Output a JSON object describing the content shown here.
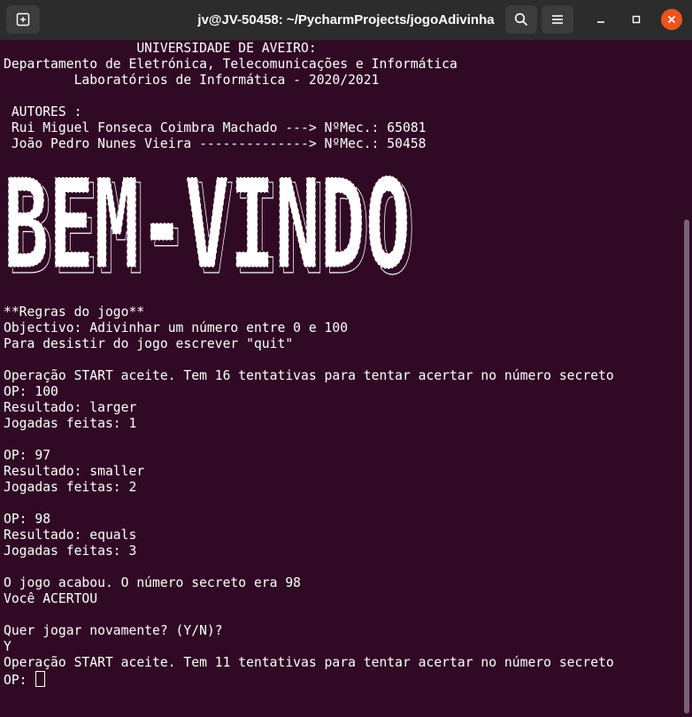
{
  "window": {
    "title": "jv@JV-50458: ~/PycharmProjects/jogoAdivinha",
    "icons": [
      "new-tab-icon",
      "search-icon",
      "hamburger-menu-icon",
      "minimize-icon",
      "maximize-icon",
      "close-icon"
    ],
    "close_color": "#e95420"
  },
  "colors": {
    "terminal_bg": "#300a24",
    "text": "#ffffff",
    "titlebar_bg": "#2c2c2c"
  },
  "header": {
    "university": "                 UNIVERSIDADE DE AVEIRO:",
    "department": "Departamento de Eletrónica, Telecomunicações e Informática",
    "lab": "         Laboratórios de Informática - 2020/2021"
  },
  "authors": {
    "heading": " AUTORES :",
    "author1": " Rui Miguel Fonseca Coimbra Machado ---> NºMec.: 65081",
    "author2": " João Pedro Nunes Vieira --------------> NºMec.: 50458"
  },
  "banner": {
    "text": "BEM-VINDO"
  },
  "rules": {
    "heading": "**Regras do jogo**",
    "objective": "Objectivo: Adivinhar um número entre 0 e 100",
    "quit": "Para desistir do jogo escrever \"quit\""
  },
  "game1": {
    "start": "Operação START aceite. Tem 16 tentativas para tentar acertar no número secreto",
    "moves": [
      {
        "op": "OP: 100",
        "result": "Resultado: larger",
        "count": "Jogadas feitas: 1"
      },
      {
        "op": "OP: 97",
        "result": "Resultado: smaller",
        "count": "Jogadas feitas: 2"
      },
      {
        "op": "OP: 98",
        "result": "Resultado: equals",
        "count": "Jogadas feitas: 3"
      }
    ],
    "end": "O jogo acabou. O número secreto era 98",
    "verdict": "Você ACERTOU"
  },
  "replay": {
    "question": "Quer jogar novamente? (Y/N)?",
    "answer": "Y",
    "start2": "Operação START aceite. Tem 11 tentativas para tentar acertar no número secreto",
    "prompt": "OP: "
  }
}
